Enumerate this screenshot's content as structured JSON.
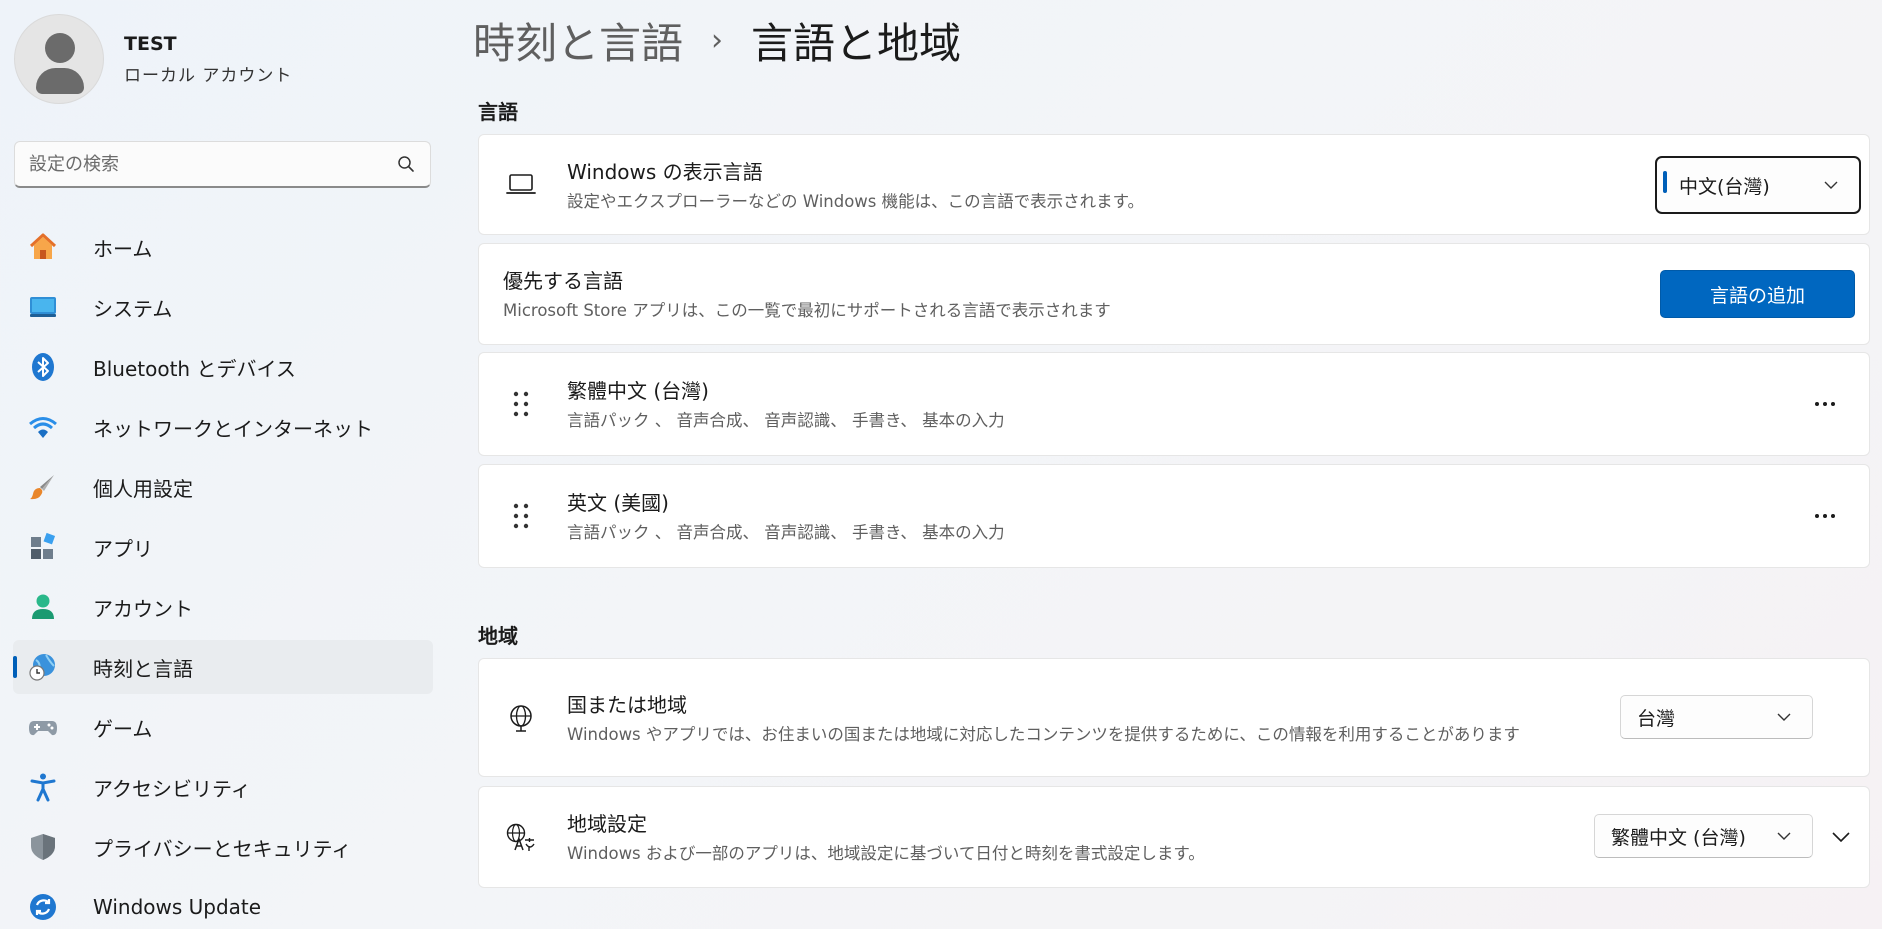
{
  "profile": {
    "name": "TEST",
    "account_type": "ローカル アカウント"
  },
  "search": {
    "placeholder": "設定の検索"
  },
  "sidebar": {
    "items": [
      {
        "label": "ホーム",
        "icon": "home-icon"
      },
      {
        "label": "システム",
        "icon": "system-icon"
      },
      {
        "label": "Bluetooth とデバイス",
        "icon": "bluetooth-icon"
      },
      {
        "label": "ネットワークとインターネット",
        "icon": "wifi-icon"
      },
      {
        "label": "個人用設定",
        "icon": "brush-icon"
      },
      {
        "label": "アプリ",
        "icon": "apps-icon"
      },
      {
        "label": "アカウント",
        "icon": "account-icon"
      },
      {
        "label": "時刻と言語",
        "icon": "time-language-icon",
        "active": true
      },
      {
        "label": "ゲーム",
        "icon": "gamepad-icon"
      },
      {
        "label": "アクセシビリティ",
        "icon": "accessibility-icon"
      },
      {
        "label": "プライバシーとセキュリティ",
        "icon": "shield-icon"
      },
      {
        "label": "Windows Update",
        "icon": "update-icon"
      }
    ]
  },
  "breadcrumb": {
    "parent": "時刻と言語",
    "separator": "›",
    "current": "言語と地域"
  },
  "language_section": {
    "title": "言語",
    "display_language": {
      "title": "Windows の表示言語",
      "description": "設定やエクスプローラーなどの Windows 機能は、この言語で表示されます。",
      "value": "中文(台灣)"
    },
    "preferred": {
      "title": "優先する言語",
      "description": "Microsoft Store アプリは、この一覧で最初にサポートされる言語で表示されます",
      "add_button": "言語の追加"
    },
    "languages": [
      {
        "name": "繁體中文 (台灣)",
        "features": "言語パック 、 音声合成、 音声認識、 手書き、 基本の入力"
      },
      {
        "name": "英文 (美國)",
        "features": "言語パック 、 音声合成、 音声認識、 手書き、 基本の入力"
      }
    ]
  },
  "region_section": {
    "title": "地域",
    "country": {
      "title": "国または地域",
      "description": "Windows やアプリでは、お住まいの国または地域に対応したコンテンツを提供するために、この情報を利用することがあります",
      "value": "台灣"
    },
    "regional_format": {
      "title": "地域設定",
      "description": "Windows および一部のアプリは、地域設定に基づいて日付と時刻を書式設定します。",
      "value": "繁體中文 (台灣)"
    }
  },
  "colors": {
    "accent": "#0067c0",
    "nav_active_bg": "#e9ecef",
    "card_bg": "#ffffff"
  }
}
